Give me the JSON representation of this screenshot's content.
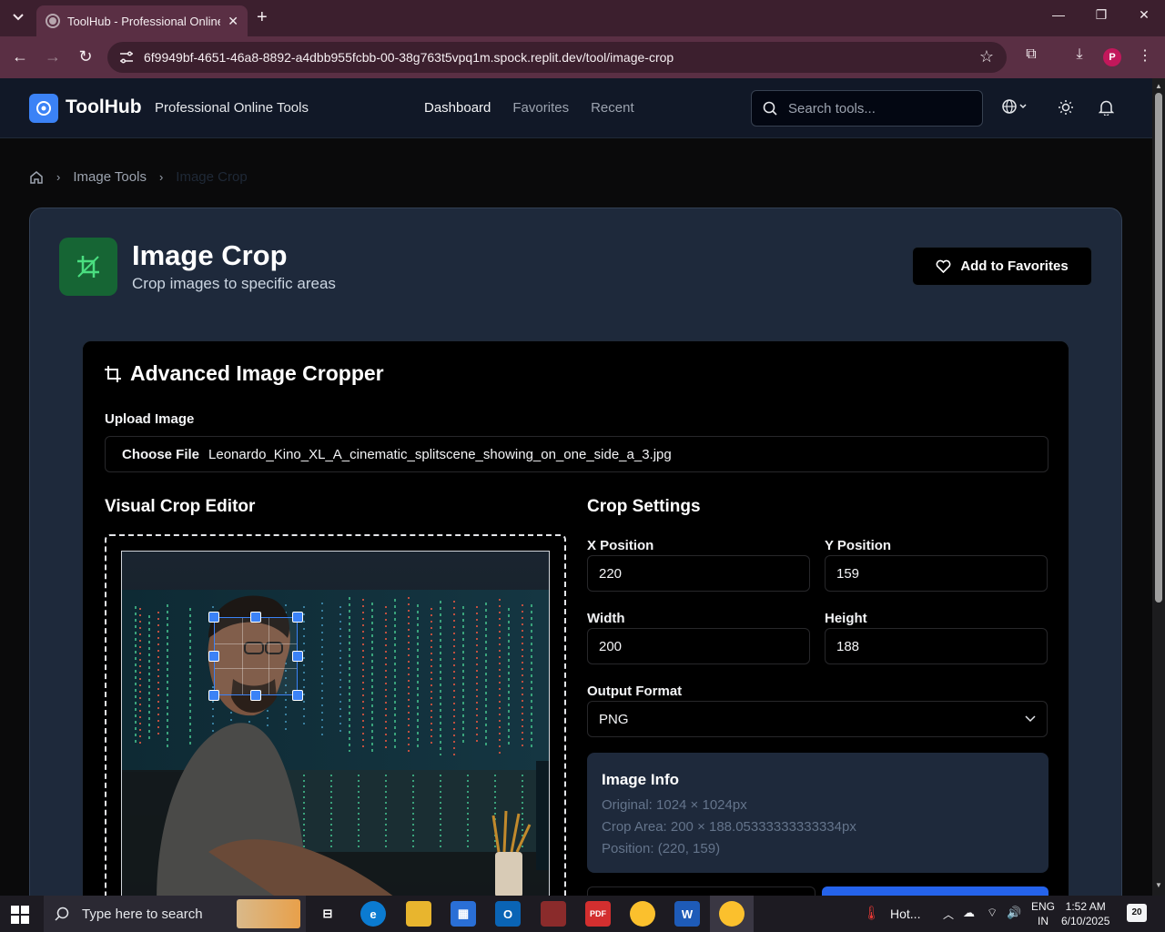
{
  "browser": {
    "tab_title": "ToolHub - Professional Online T",
    "url": "6f9949bf-4651-46a8-8892-a4dbb955fcbb-00-38g763t5vpq1m.spock.replit.dev/tool/image-crop",
    "profile_initial": "P"
  },
  "header": {
    "brand": "ToolHub",
    "tagline": "Professional Online Tools",
    "nav": [
      "Dashboard",
      "Favorites",
      "Recent"
    ],
    "active_nav": "Dashboard",
    "search_placeholder": "Search tools..."
  },
  "breadcrumb": {
    "items": [
      "Image Tools",
      "Image Crop"
    ]
  },
  "tool": {
    "title": "Image Crop",
    "subtitle": "Crop images to specific areas",
    "favorite_label": "Add to Favorites"
  },
  "cropper": {
    "title": "Advanced Image Cropper",
    "upload_label": "Upload Image",
    "choose_file_label": "Choose File",
    "file_name": "Leonardo_Kino_XL_A_cinematic_splitscene_showing_on_one_side_a_3.jpg",
    "editor_title": "Visual Crop Editor",
    "settings_title": "Crop Settings",
    "x_label": "X Position",
    "x_value": "220",
    "y_label": "Y Position",
    "y_value": "159",
    "width_label": "Width",
    "width_value": "200",
    "height_label": "Height",
    "height_value": "188",
    "format_label": "Output Format",
    "format_value": "PNG"
  },
  "image_info": {
    "title": "Image Info",
    "original": "Original: 1024 × 1024px",
    "crop_area": "Crop Area: 200 × 188.05333333333334px",
    "position": "Position: (220, 159)"
  },
  "taskbar": {
    "search_placeholder": "Type here to search",
    "weather": "Hot...",
    "lang_top": "ENG",
    "lang_bottom": "IN",
    "time": "1:52 AM",
    "date": "6/10/2025",
    "notifications": "20"
  },
  "colors": {
    "accent": "#3b82f6",
    "tool_icon_bg": "#166534",
    "card_bg": "#1e293b",
    "tab_bar": "#3c1f2e"
  }
}
